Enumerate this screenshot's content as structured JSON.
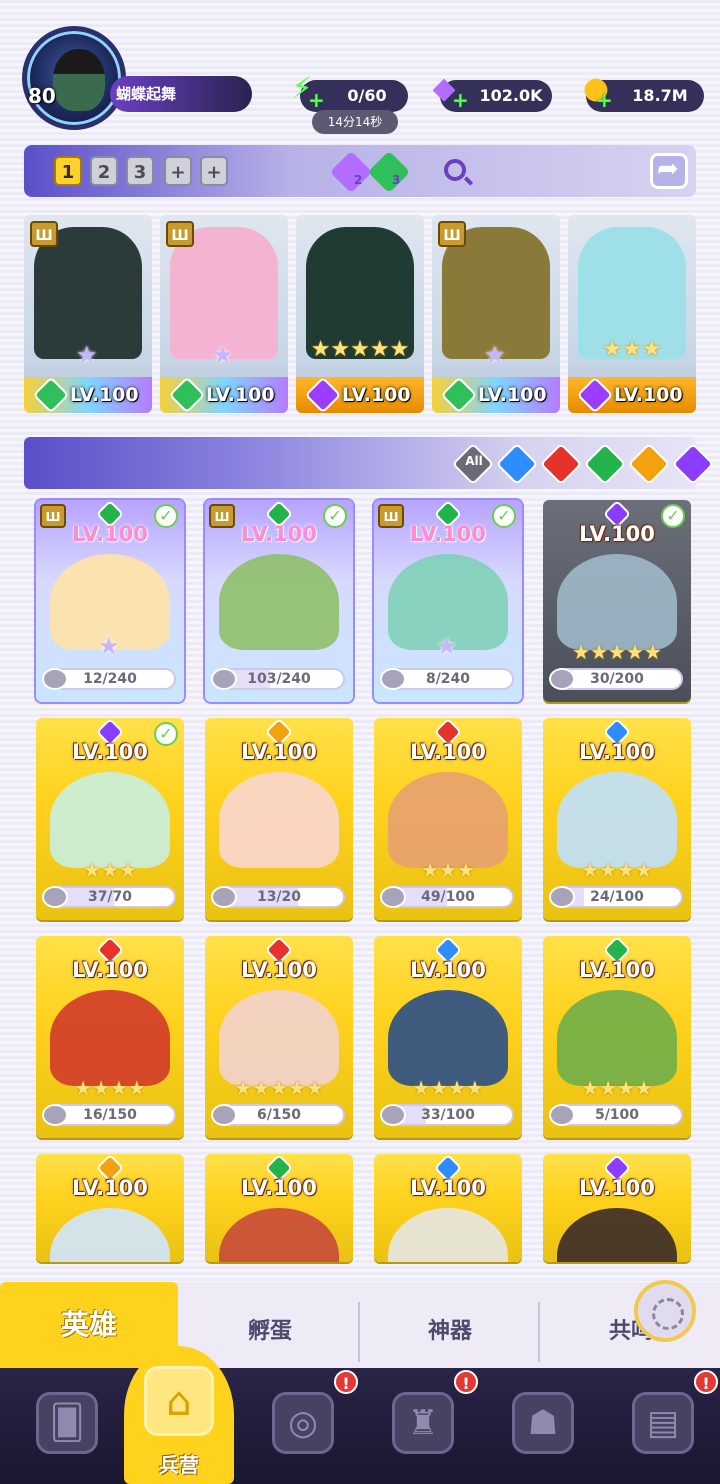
{
  "player": {
    "level": "80",
    "name": "蝴蝶起舞"
  },
  "resources": {
    "energy": {
      "value": "0/60",
      "timer": "14分14秒",
      "icon": "lightning-icon"
    },
    "gems": {
      "value": "102.0K",
      "icon": "diamond-icon"
    },
    "gold": {
      "value": "18.7M",
      "icon": "coin-icon"
    }
  },
  "team_bar": {
    "tabs": [
      "1",
      "2",
      "3",
      "+",
      "+"
    ],
    "active_tab": "1",
    "badges": [
      {
        "count": "2",
        "color": "#b26cff"
      },
      {
        "count": "3",
        "color": "#2fbf5b"
      }
    ]
  },
  "team": [
    {
      "level": "LV.100",
      "element_color": "#2fbf5b",
      "frame": "rainbow",
      "harp": true,
      "stars": "★",
      "art_color": "#2a3b3a"
    },
    {
      "level": "LV.100",
      "element_color": "#2fbf5b",
      "frame": "rainbow",
      "harp": true,
      "stars": "★",
      "art_color": "#f3b3d1"
    },
    {
      "level": "LV.100",
      "element_color": "#9b3cff",
      "frame": "gold",
      "harp": false,
      "stars": "★★★★★",
      "art_color": "#1f3b32"
    },
    {
      "level": "LV.100",
      "element_color": "#2fbf5b",
      "frame": "rainbow",
      "harp": true,
      "stars": "★",
      "art_color": "#8a7a3a"
    },
    {
      "level": "LV.100",
      "element_color": "#9b3cff",
      "frame": "gold",
      "harp": false,
      "stars": "★★★",
      "art_color": "#9fe0e8"
    }
  ],
  "filters": {
    "all_label": "All",
    "elements": [
      {
        "name": "water",
        "color": "#2f8cff"
      },
      {
        "name": "fire",
        "color": "#e5322b"
      },
      {
        "name": "wind",
        "color": "#22b34a"
      },
      {
        "name": "light",
        "color": "#f2a20c"
      },
      {
        "name": "dark",
        "color": "#8a3cff"
      }
    ]
  },
  "heroes": [
    {
      "level": "LV.100",
      "element_color": "#22b34a",
      "frame": "rainbow",
      "harp": true,
      "check": true,
      "stars": "★",
      "shards": "12/240",
      "shard_ratio": 0.05,
      "art_color": "#ffe3a6"
    },
    {
      "level": "LV.100",
      "element_color": "#22b34a",
      "frame": "rainbow",
      "harp": true,
      "check": true,
      "stars": "",
      "shards": "103/240",
      "shard_ratio": 0.43,
      "art_color": "#8fbf6a"
    },
    {
      "level": "LV.100",
      "element_color": "#22b34a",
      "frame": "rainbow",
      "harp": true,
      "check": true,
      "stars": "★",
      "shards": "8/240",
      "shard_ratio": 0.03,
      "art_color": "#7fd0b8"
    },
    {
      "level": "LV.100",
      "element_color": "#8a3cff",
      "frame": "gray",
      "harp": false,
      "check": true,
      "stars": "★★★★★",
      "shards": "30/200",
      "shard_ratio": 0.15,
      "art_color": "#9fb8c8"
    },
    {
      "level": "LV.100",
      "element_color": "#8a3cff",
      "frame": "gold",
      "harp": false,
      "check": true,
      "stars": "★★★",
      "shards": "37/70",
      "shard_ratio": 0.53,
      "art_color": "#c8f0e0"
    },
    {
      "level": "LV.100",
      "element_color": "#f2a20c",
      "frame": "gold",
      "harp": false,
      "check": false,
      "stars": "",
      "shards": "13/20",
      "shard_ratio": 0.65,
      "art_color": "#fbd6d0"
    },
    {
      "level": "LV.100",
      "element_color": "#e5322b",
      "frame": "gold",
      "harp": false,
      "check": false,
      "stars": "★★★",
      "shards": "49/100",
      "shard_ratio": 0.49,
      "art_color": "#e8a070"
    },
    {
      "level": "LV.100",
      "element_color": "#2f8cff",
      "frame": "gold",
      "harp": false,
      "check": false,
      "stars": "★★★★",
      "shards": "24/100",
      "shard_ratio": 0.24,
      "art_color": "#bfe0ff"
    },
    {
      "level": "LV.100",
      "element_color": "#e5322b",
      "frame": "gold",
      "harp": false,
      "check": false,
      "stars": "★★★★",
      "shards": "16/150",
      "shard_ratio": 0.11,
      "art_color": "#d23a2a"
    },
    {
      "level": "LV.100",
      "element_color": "#e5322b",
      "frame": "gold",
      "harp": false,
      "check": false,
      "stars": "★★★★★",
      "shards": "6/150",
      "shard_ratio": 0.04,
      "art_color": "#f2d3d0"
    },
    {
      "level": "LV.100",
      "element_color": "#2f8cff",
      "frame": "gold",
      "harp": false,
      "check": false,
      "stars": "★★★★",
      "shards": "33/100",
      "shard_ratio": 0.33,
      "art_color": "#2a4f8a"
    },
    {
      "level": "LV.100",
      "element_color": "#22b34a",
      "frame": "gold",
      "harp": false,
      "check": false,
      "stars": "★★★★",
      "shards": "5/100",
      "shard_ratio": 0.05,
      "art_color": "#6fae4a"
    },
    {
      "level": "LV.100",
      "element_color": "#f2a20c",
      "frame": "gold",
      "harp": false,
      "check": false,
      "stars": "",
      "shards": "",
      "shard_ratio": 0,
      "art_color": "#cfe6ff"
    },
    {
      "level": "LV.100",
      "element_color": "#22b34a",
      "frame": "gold",
      "harp": false,
      "check": false,
      "stars": "",
      "shards": "",
      "shard_ratio": 0,
      "art_color": "#c84a3a"
    },
    {
      "level": "LV.100",
      "element_color": "#2f8cff",
      "frame": "gold",
      "harp": false,
      "check": false,
      "stars": "",
      "shards": "",
      "shard_ratio": 0,
      "art_color": "#e6e6e6"
    },
    {
      "level": "LV.100",
      "element_color": "#8a3cff",
      "frame": "gold",
      "harp": false,
      "check": false,
      "stars": "",
      "shards": "",
      "shard_ratio": 0,
      "art_color": "#3a2a2a"
    }
  ],
  "sub_tabs": [
    "英雄",
    "孵蛋",
    "神器",
    "共鸣"
  ],
  "active_sub_tab": "英雄",
  "bottom_nav": [
    {
      "label": "",
      "icon": "cards-icon",
      "glyph": "🂠",
      "alert": false
    },
    {
      "label": "兵营",
      "icon": "barracks-icon",
      "glyph": "⌂",
      "alert": false,
      "active": true
    },
    {
      "label": "",
      "icon": "shop-icon",
      "glyph": "◎",
      "alert": true
    },
    {
      "label": "",
      "icon": "castle-icon",
      "glyph": "♜",
      "alert": true
    },
    {
      "label": "",
      "icon": "guild-icon",
      "glyph": "☗",
      "alert": false
    },
    {
      "label": "",
      "icon": "scroll-icon",
      "glyph": "▤",
      "alert": true
    }
  ],
  "alert_mark": "!"
}
